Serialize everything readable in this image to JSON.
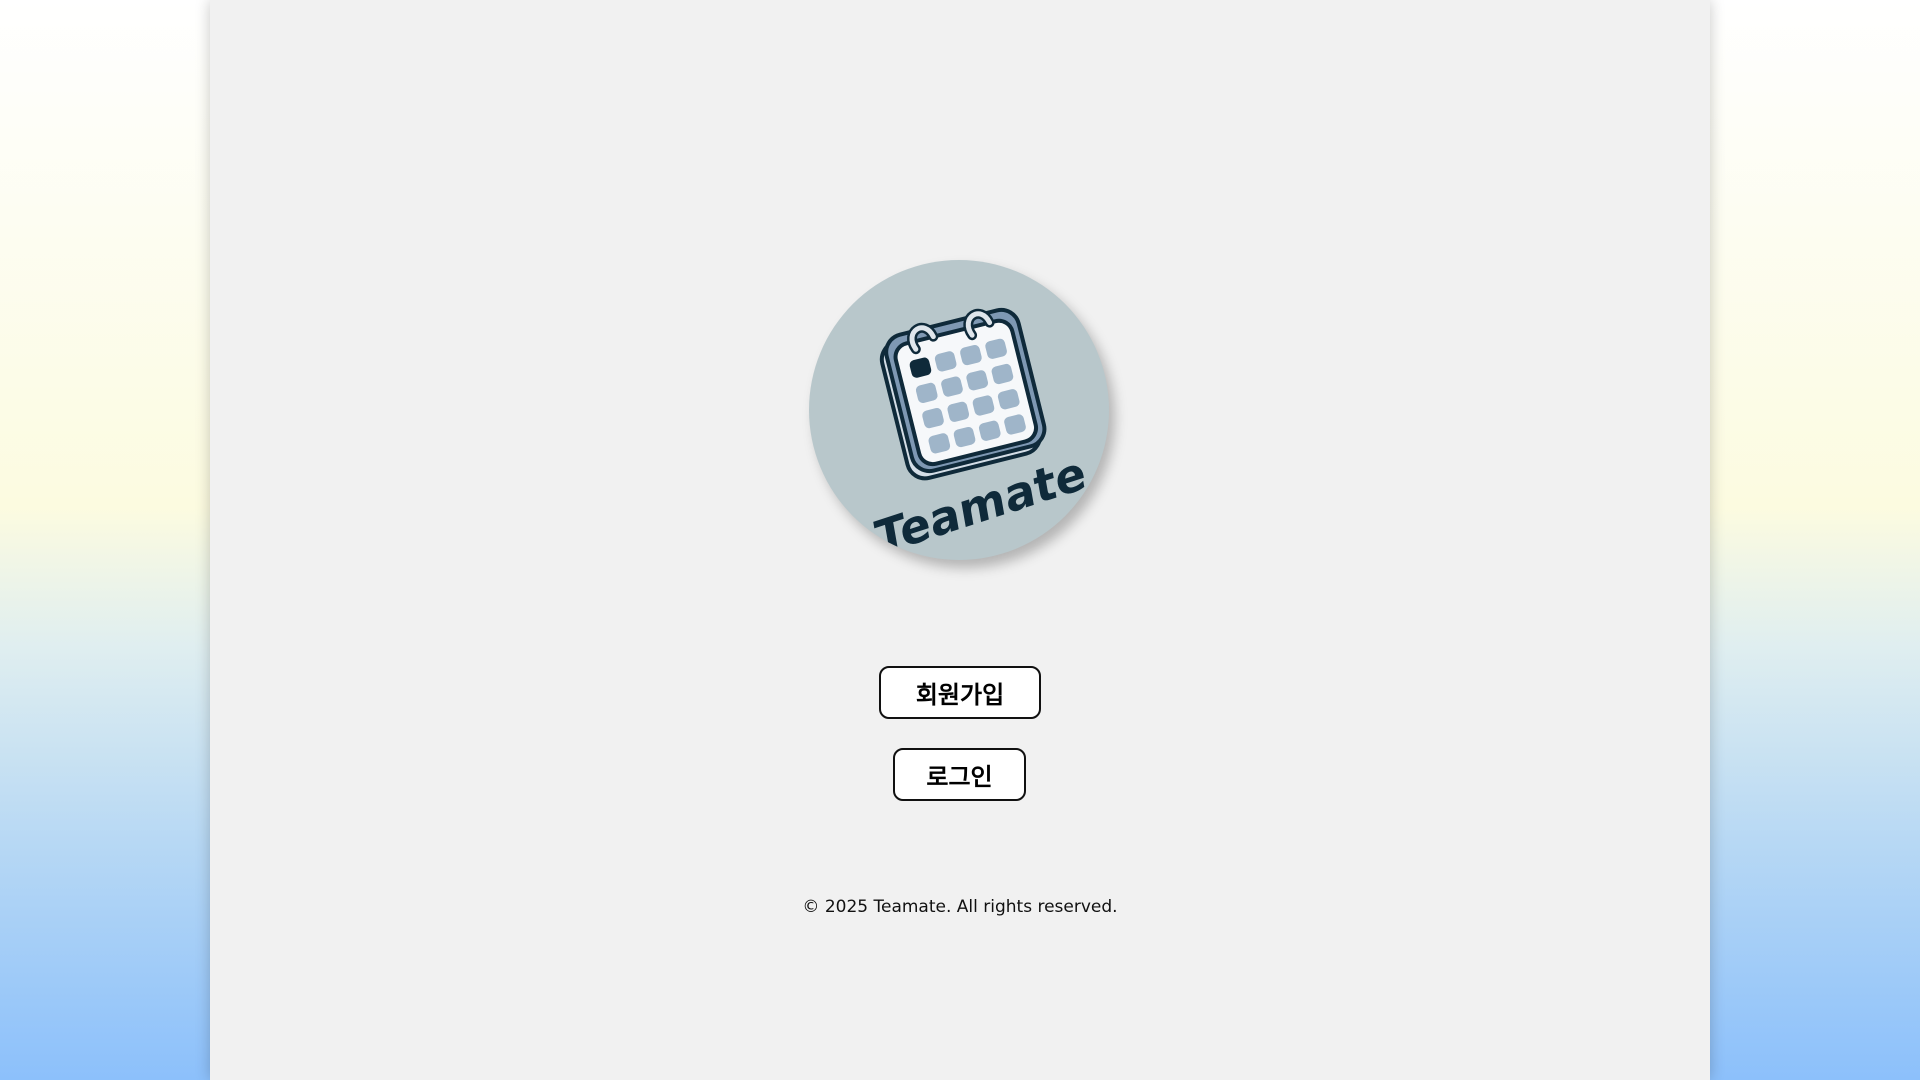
{
  "logo": {
    "brand_text": "Teamate",
    "icon": "calendar-icon"
  },
  "actions": {
    "signup_label": "회원가입",
    "login_label": "로그인"
  },
  "footer": {
    "copyright": "© 2025 Teamate. All rights reserved."
  },
  "colors": {
    "page_bg": "#f1f1f1",
    "logo_circle": "#b8c7cb",
    "logo_ink": "#0f2a3a",
    "calendar_cell": "#9fb5c9",
    "button_bg": "#ffffff",
    "button_border": "#111111"
  }
}
